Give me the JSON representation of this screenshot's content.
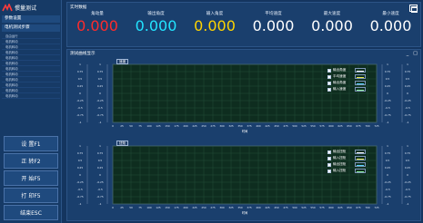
{
  "app": {
    "title": "惯量测试"
  },
  "sidebar": {
    "param_header": "参数设置",
    "test_header": "电机测试步骤",
    "menu_items": [
      "自由运行",
      "电机转动",
      "电机转动",
      "电机转动",
      "电机转动",
      "电机转动",
      "电机转动",
      "电机转动",
      "电机转动",
      "电机转动",
      "电机转动",
      "电机转动"
    ],
    "buttons": [
      "设 置F1",
      "正 转F2",
      "开 始F5",
      "打 印F5",
      "结束ESC"
    ]
  },
  "realtime": {
    "title": "实时数据",
    "items": [
      {
        "label": "角动量 ",
        "value": "0.000",
        "color": "#ff2b2b"
      },
      {
        "label": "输出角度",
        "value": "0.000",
        "color": "#22e4ff"
      },
      {
        "label": "输入角度",
        "value": "0.000",
        "color": "#ffd400"
      },
      {
        "label": "平均速度",
        "value": "0.000",
        "color": "#ffffff"
      },
      {
        "label": "最大速度",
        "value": "0.000",
        "color": "#ffffff"
      },
      {
        "label": "最小速度",
        "value": "0.000",
        "color": "#ffffff"
      }
    ]
  },
  "curves": {
    "title": "测试曲线显示",
    "window_buttons": [
      "_",
      "□"
    ],
    "charts": [
      {
        "chip": "速度",
        "legend": [
          {
            "name": "输出角度",
            "color": "#ffffff"
          },
          {
            "name": "平均速度",
            "color": "#e7e94a"
          },
          {
            "name": "输出角度",
            "color": "#54d6ff"
          },
          {
            "name": "输入速度",
            "color": "#8ef0a0"
          }
        ],
        "xticks": [
          "0",
          "25",
          "50",
          "75",
          "100",
          "125",
          "150",
          "175",
          "200",
          "225",
          "250",
          "275",
          "300",
          "325",
          "350",
          "375",
          "400",
          "425",
          "450",
          "475",
          "500",
          "525",
          "550",
          "575",
          "600",
          "625",
          "650",
          "675",
          "700",
          "725"
        ],
        "xlabel": "时间",
        "yticks_left_a": [
          "1",
          "0.75",
          "0.5",
          "0.25",
          "0",
          "-0.25",
          "-0.5",
          "-0.75",
          "-1"
        ],
        "yticks_left_b": [
          "1",
          "0.75",
          "0.5",
          "0.25",
          "0",
          "-0.25",
          "-0.5",
          "-0.75",
          "-1"
        ],
        "yticks_right_a": [
          "1",
          "0.75",
          "0.5",
          "0.25",
          "0",
          "-0.25",
          "-0.5",
          "-0.75",
          "-1"
        ],
        "yticks_right_b": [
          "1",
          "0.75",
          "0.5",
          "0.25",
          "0",
          "-0.25",
          "-0.5",
          "-0.75",
          "-1"
        ]
      },
      {
        "chip": "扭矩",
        "legend": [
          {
            "name": "输出扭矩",
            "color": "#ffffff"
          },
          {
            "name": "输入扭矩",
            "color": "#e7e94a"
          },
          {
            "name": "输出扭矩",
            "color": "#54d6ff"
          },
          {
            "name": "输入扭矩",
            "color": "#8ef0a0"
          }
        ],
        "xticks": [
          "0",
          "25",
          "50",
          "75",
          "100",
          "125",
          "150",
          "175",
          "200",
          "225",
          "250",
          "275",
          "300",
          "325",
          "350",
          "375",
          "400",
          "425",
          "450",
          "475",
          "500",
          "525",
          "550",
          "575",
          "600",
          "625",
          "650",
          "675",
          "700",
          "725"
        ],
        "xlabel": "时间",
        "yticks_left_a": [
          "1",
          "0.75",
          "0.5",
          "0.25",
          "0",
          "-0.25",
          "-0.5",
          "-0.75",
          "-1"
        ],
        "yticks_left_b": [
          "1",
          "0.75",
          "0.5",
          "0.25",
          "0",
          "-0.25",
          "-0.5",
          "-0.75",
          "-1"
        ],
        "yticks_right_a": [
          "1",
          "0.75",
          "0.5",
          "0.25",
          "0",
          "-0.25",
          "-0.5",
          "-0.75",
          "-1"
        ],
        "yticks_right_b": [
          "1",
          "0.75",
          "0.5",
          "0.25",
          "0",
          "-0.25",
          "-0.5",
          "-0.75",
          "-1"
        ]
      }
    ]
  }
}
